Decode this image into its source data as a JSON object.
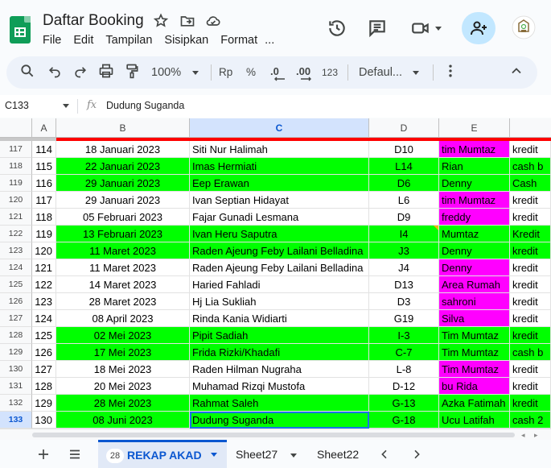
{
  "doc": {
    "title": "Daftar Booking"
  },
  "menu": [
    "File",
    "Edit",
    "Tampilan",
    "Sisipkan",
    "Format",
    "..."
  ],
  "toolbar": {
    "zoom": "100%",
    "currency": "Rp",
    "percent": "%",
    "dec_decrease": ".0",
    "dec_increase": ".00",
    "number_format": "123",
    "font": "Defaul..."
  },
  "formula_bar": {
    "cell_ref": "C133",
    "fx": "fx",
    "value": "Dudung Suganda"
  },
  "columns": [
    "A",
    "B",
    "C",
    "D",
    "E"
  ],
  "rows": [
    {
      "rn": "117",
      "a": "114",
      "b": "18 Januari 2023",
      "c": "Siti Nur Halimah",
      "d": "D10",
      "e": "tim Mumtaz",
      "f": "kredit",
      "bg": "w",
      "ebg": "m"
    },
    {
      "rn": "118",
      "a": "115",
      "b": "22 Januari 2023",
      "c": "Imas Hermiati",
      "d": "L14",
      "e": "Rian",
      "f": "cash b",
      "bg": "g",
      "ebg": "g"
    },
    {
      "rn": "119",
      "a": "116",
      "b": "29 Januari 2023",
      "c": "Eep Erawan",
      "d": "D6",
      "e": "Denny",
      "f": "Cash",
      "bg": "g",
      "ebg": "g"
    },
    {
      "rn": "120",
      "a": "117",
      "b": "29 Januari 2023",
      "c": "Ivan Septian Hidayat",
      "d": "L6",
      "e": "tim Mumtaz",
      "f": "kredit",
      "bg": "w",
      "ebg": "m"
    },
    {
      "rn": "121",
      "a": "118",
      "b": "05 Februari 2023",
      "c": "Fajar Gunadi Lesmana",
      "d": "D9",
      "e": "freddy",
      "f": "kredit",
      "bg": "w",
      "ebg": "m"
    },
    {
      "rn": "122",
      "a": "119",
      "b": "13 Februari 2023",
      "c": "Ivan Heru Saputra",
      "d": "I4",
      "e": "Mumtaz",
      "f": "Kredit",
      "bg": "g",
      "ebg": "g",
      "note": true
    },
    {
      "rn": "123",
      "a": "120",
      "b": "11 Maret 2023",
      "c": "Raden Ajeung Feby Lailani Belladina",
      "d": "J3",
      "e": "Denny",
      "f": "kredit",
      "bg": "g",
      "ebg": "g"
    },
    {
      "rn": "124",
      "a": "121",
      "b": "11 Maret 2023",
      "c": "Raden Ajeung Feby Lailani Belladina",
      "d": "J4",
      "e": "Denny",
      "f": "kredit",
      "bg": "w",
      "ebg": "m"
    },
    {
      "rn": "125",
      "a": "122",
      "b": "14 Maret 2023",
      "c": "Haried Fahladi",
      "d": "D13",
      "e": "Area Rumah",
      "f": "kredit",
      "bg": "w",
      "ebg": "m"
    },
    {
      "rn": "126",
      "a": "123",
      "b": "28 Maret 2023",
      "c": "Hj Lia Sukliah",
      "d": "D3",
      "e": "sahroni",
      "f": "kredit",
      "bg": "w",
      "ebg": "m"
    },
    {
      "rn": "127",
      "a": "124",
      "b": "08 April 2023",
      "c": "Rinda Kania Widiarti",
      "d": "G19",
      "e": "Silva",
      "f": "kredit",
      "bg": "w",
      "ebg": "m"
    },
    {
      "rn": "128",
      "a": "125",
      "b": "02 Mei 2023",
      "c": "Pipit Sadiah",
      "d": "I-3",
      "e": "Tim Mumtaz",
      "f": "kredit",
      "bg": "g",
      "ebg": "g"
    },
    {
      "rn": "129",
      "a": "126",
      "b": "17 Mei 2023",
      "c": "Frida Rizki/Khadafi",
      "d": "C-7",
      "e": "Tim Mumtaz",
      "f": "cash b",
      "bg": "g",
      "ebg": "g"
    },
    {
      "rn": "130",
      "a": "127",
      "b": "18 Mei 2023",
      "c": "Raden Hilman Nugraha",
      "d": "L-8",
      "e": "Tim Mumtaz",
      "f": "kredit",
      "bg": "w",
      "ebg": "m"
    },
    {
      "rn": "131",
      "a": "128",
      "b": "20 Mei 2023",
      "c": "Muhamad Rizqi Mustofa",
      "d": "D-12",
      "e": "bu Rida",
      "f": "kredit",
      "bg": "w",
      "ebg": "m"
    },
    {
      "rn": "132",
      "a": "129",
      "b": "28 Mei 2023",
      "c": "Rahmat Saleh",
      "d": "G-13",
      "e": "Azka Fatimah",
      "f": "kredit",
      "bg": "g",
      "ebg": "g"
    },
    {
      "rn": "133",
      "a": "130",
      "b": "08 Juni 2023",
      "c": "Dudung Suganda",
      "d": "G-18",
      "e": "Ucu Latifah",
      "f": "cash 2",
      "bg": "g",
      "ebg": "g",
      "selected": true
    }
  ],
  "sheets": {
    "active_badge": "28",
    "active": "REKAP AKAD",
    "others": [
      "Sheet27",
      "Sheet22"
    ]
  },
  "colors": {
    "green": "#00ff00",
    "magenta": "#ff00ff",
    "accent": "#0b57d0"
  }
}
